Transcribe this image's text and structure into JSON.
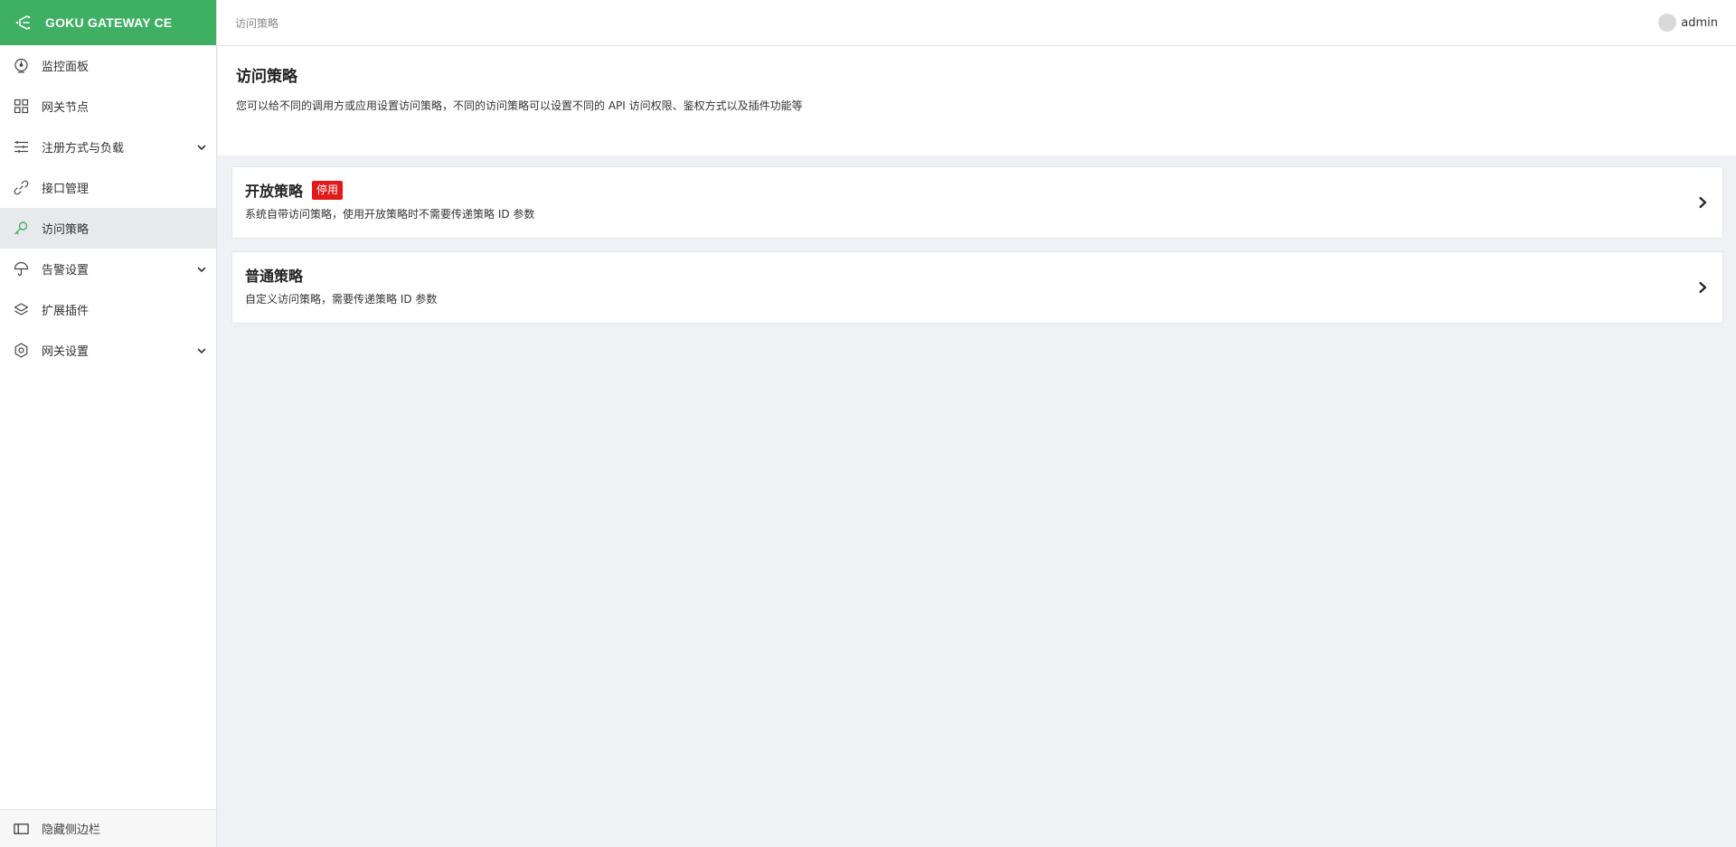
{
  "brand": {
    "title": "GOKU GATEWAY CE",
    "color": "#3eaf63"
  },
  "sidebar": {
    "items": [
      {
        "label": "监控面板",
        "icon": "dashboard-icon",
        "expandable": false,
        "active": false
      },
      {
        "label": "网关节点",
        "icon": "grid-icon",
        "expandable": false,
        "active": false
      },
      {
        "label": "注册方式与负载",
        "icon": "sliders-icon",
        "expandable": true,
        "active": false
      },
      {
        "label": "接口管理",
        "icon": "link-icon",
        "expandable": false,
        "active": false
      },
      {
        "label": "访问策略",
        "icon": "key-icon",
        "expandable": false,
        "active": true
      },
      {
        "label": "告警设置",
        "icon": "umbrella-icon",
        "expandable": true,
        "active": false
      },
      {
        "label": "扩展插件",
        "icon": "layers-icon",
        "expandable": false,
        "active": false
      },
      {
        "label": "网关设置",
        "icon": "gear-icon",
        "expandable": true,
        "active": false
      }
    ],
    "footer_label": "隐藏侧边栏"
  },
  "topbar": {
    "breadcrumb": "访问策略",
    "user_name": "admin"
  },
  "page": {
    "title": "访问策略",
    "description": "您可以给不同的调用方或应用设置访问策略，不同的访问策略可以设置不同的 API 访问权限、鉴权方式以及插件功能等"
  },
  "cards": [
    {
      "title": "开放策略",
      "badge": "停用",
      "badge_color": "#e11b1b",
      "description": "系统自带访问策略，使用开放策略时不需要传递策略 ID 参数"
    },
    {
      "title": "普通策略",
      "description": "自定义访问策略，需要传递策略 ID 参数"
    }
  ]
}
